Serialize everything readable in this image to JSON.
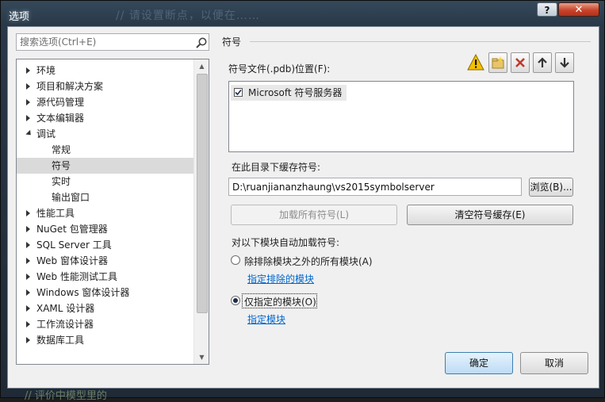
{
  "window": {
    "title": "选项",
    "background_text": "// 请设置断点，以便在……",
    "bottom_background_text": "//   评价中模型里的",
    "help_label": "?",
    "close_label": "✕"
  },
  "search": {
    "placeholder": "搜索选项(Ctrl+E)"
  },
  "tree": [
    {
      "label": "环境",
      "arrow": "right",
      "level": 0
    },
    {
      "label": "项目和解决方案",
      "arrow": "right",
      "level": 0
    },
    {
      "label": "源代码管理",
      "arrow": "right",
      "level": 0
    },
    {
      "label": "文本编辑器",
      "arrow": "right",
      "level": 0
    },
    {
      "label": "调试",
      "arrow": "down",
      "level": 0
    },
    {
      "label": "常规",
      "arrow": "",
      "level": 1
    },
    {
      "label": "符号",
      "arrow": "",
      "level": 1,
      "selected": true
    },
    {
      "label": "实时",
      "arrow": "",
      "level": 1
    },
    {
      "label": "输出窗口",
      "arrow": "",
      "level": 1
    },
    {
      "label": "性能工具",
      "arrow": "right",
      "level": 0
    },
    {
      "label": "NuGet 包管理器",
      "arrow": "right",
      "level": 0
    },
    {
      "label": "SQL Server 工具",
      "arrow": "right",
      "level": 0
    },
    {
      "label": "Web 窗体设计器",
      "arrow": "right",
      "level": 0
    },
    {
      "label": "Web 性能测试工具",
      "arrow": "right",
      "level": 0
    },
    {
      "label": "Windows 窗体设计器",
      "arrow": "right",
      "level": 0
    },
    {
      "label": "XAML 设计器",
      "arrow": "right",
      "level": 0
    },
    {
      "label": "工作流设计器",
      "arrow": "right",
      "level": 0
    },
    {
      "label": "数据库工具",
      "arrow": "right",
      "level": 0
    }
  ],
  "panel": {
    "section_title": "符号",
    "symbol_locations_label": "符号文件(.pdb)位置(F):",
    "locations": [
      {
        "label": "Microsoft 符号服务器",
        "checked": true
      }
    ],
    "cache_label": "在此目录下缓存符号:",
    "cache_path": "D:\\ruanjiananzhaung\\vs2015symbolserver",
    "browse_button": "浏览(B)...",
    "load_all_button": "加载所有符号(L)",
    "clear_cache_button": "清空符号缓存(E)",
    "auto_load_label": "对以下模块自动加载符号:",
    "radio_all_except": "除排除模块之外的所有模块(A)",
    "link_excluded": "指定排除的模块",
    "radio_only_specified": "仅指定的模块(O)",
    "link_specified": "指定模块"
  },
  "footer": {
    "ok_button": "确定",
    "cancel_button": "取消"
  },
  "colors": {
    "link": "#0066cc",
    "warning": "#f4c000",
    "delete_red": "#c0392b"
  }
}
